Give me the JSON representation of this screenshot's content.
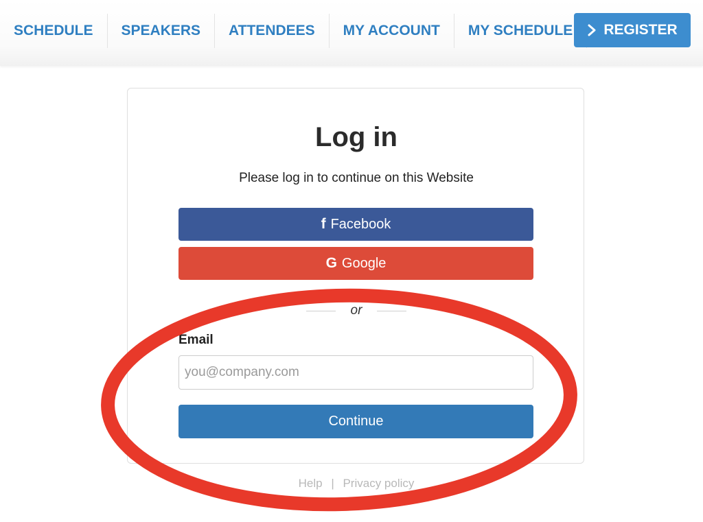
{
  "nav": {
    "items": [
      {
        "label": "SCHEDULE"
      },
      {
        "label": "SPEAKERS"
      },
      {
        "label": "ATTENDEES"
      },
      {
        "label": "MY ACCOUNT"
      },
      {
        "label": "MY SCHEDULE"
      }
    ],
    "register": {
      "label": "REGISTER",
      "icon": "chevron-right-icon"
    }
  },
  "login": {
    "title": "Log in",
    "subtitle": "Please log in to continue on this Website",
    "facebook": {
      "label": "Facebook",
      "icon": "facebook-icon",
      "icon_glyph": "f"
    },
    "google": {
      "label": "Google",
      "icon": "google-icon",
      "icon_glyph": "G"
    },
    "divider_text": "or",
    "email": {
      "label": "Email",
      "placeholder": "you@company.com",
      "value": ""
    },
    "continue_label": "Continue"
  },
  "footer": {
    "help": "Help",
    "separator": "|",
    "privacy": "Privacy policy"
  },
  "colors": {
    "nav_text": "#2f7fc1",
    "register_bg": "#3d8dcf",
    "facebook_bg": "#3b5998",
    "google_bg": "#dd4b39",
    "continue_bg": "#337ab7",
    "annotation": "#e8392a"
  }
}
